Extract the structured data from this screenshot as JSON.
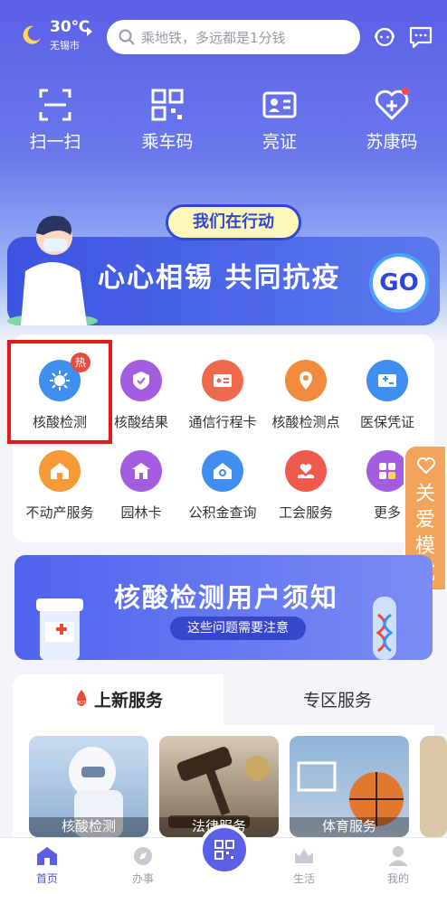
{
  "weather": {
    "temp": "30℃",
    "city": "无锡市",
    "icon": "moon-cloud-icon"
  },
  "search": {
    "placeholder": "乘地铁，多远都是1分钱"
  },
  "quick": [
    {
      "label": "扫一扫",
      "icon": "scan-icon"
    },
    {
      "label": "乘车码",
      "icon": "qr-code-icon"
    },
    {
      "label": "亮证",
      "icon": "id-card-icon"
    },
    {
      "label": "苏康码",
      "icon": "health-heart-icon"
    }
  ],
  "banner": {
    "pill": "我们在行动",
    "title": "心心相锡 共同抗疫",
    "go": "GO"
  },
  "services": [
    {
      "label": "核酸检测",
      "color": "#3f8ef0",
      "badge": "热"
    },
    {
      "label": "核酸结果",
      "color": "#a45ce0"
    },
    {
      "label": "通信行程卡",
      "color": "#ef6a4c"
    },
    {
      "label": "核酸检测点",
      "color": "#f08a3c"
    },
    {
      "label": "医保凭证",
      "color": "#3f8ef0"
    },
    {
      "label": "不动产服务",
      "color": "#f59a36"
    },
    {
      "label": "园林卡",
      "color": "#a45ce0"
    },
    {
      "label": "公积金查询",
      "color": "#3f8ef0"
    },
    {
      "label": "工会服务",
      "color": "#ef5a4c"
    },
    {
      "label": "更多",
      "color": "#a45ce0"
    }
  ],
  "care_mode": "关爱模式",
  "notice": {
    "title": "核酸检测用户须知",
    "pill": "这些问题需要注意"
  },
  "tabs": {
    "active": "上新服务",
    "inactive": "专区服务",
    "hot_badge": "HOT"
  },
  "thumbs": [
    {
      "caption": "核酸检测"
    },
    {
      "caption": "法律服务"
    },
    {
      "caption": "体育服务"
    }
  ],
  "nav": {
    "home": "首页",
    "tasks": "办事",
    "life": "生活",
    "mine": "我的"
  }
}
